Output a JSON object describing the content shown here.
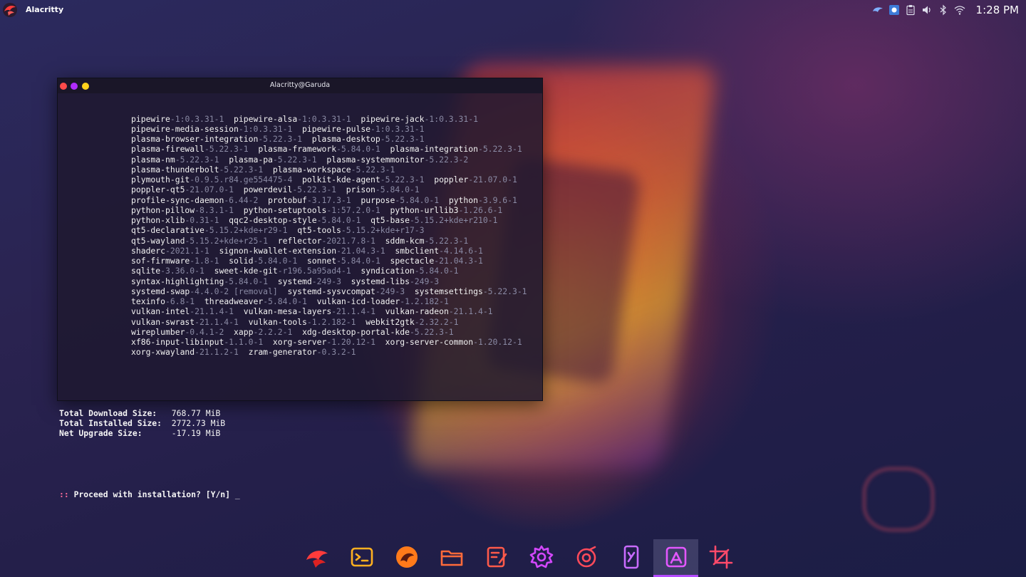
{
  "topbar": {
    "app_name": "Alacritty",
    "clock": "1:28 PM",
    "tray_icons": [
      "falcon-icon",
      "display-icon",
      "clipboard-icon",
      "volume-icon",
      "bluetooth-icon",
      "wifi-icon"
    ]
  },
  "terminal": {
    "title": "Alacritty@Garuda",
    "packages": [
      [
        [
          "pipewire",
          "-1:0.3.31-1"
        ],
        [
          "pipewire-alsa",
          "-1:0.3.31-1"
        ],
        [
          "pipewire-jack",
          "-1:0.3.31-1"
        ]
      ],
      [
        [
          "pipewire-media-session",
          "-1:0.3.31-1"
        ],
        [
          "pipewire-pulse",
          "-1:0.3.31-1"
        ]
      ],
      [
        [
          "plasma-browser-integration",
          "-5.22.3-1"
        ],
        [
          "plasma-desktop",
          "-5.22.3-1"
        ]
      ],
      [
        [
          "plasma-firewall",
          "-5.22.3-1"
        ],
        [
          "plasma-framework",
          "-5.84.0-1"
        ],
        [
          "plasma-integration",
          "-5.22.3-1"
        ]
      ],
      [
        [
          "plasma-nm",
          "-5.22.3-1"
        ],
        [
          "plasma-pa",
          "-5.22.3-1"
        ],
        [
          "plasma-systemmonitor",
          "-5.22.3-2"
        ]
      ],
      [
        [
          "plasma-thunderbolt",
          "-5.22.3-1"
        ],
        [
          "plasma-workspace",
          "-5.22.3-1"
        ]
      ],
      [
        [
          "plymouth-git",
          "-0.9.5.r84.ge554475-4"
        ],
        [
          "polkit-kde-agent",
          "-5.22.3-1"
        ],
        [
          "poppler",
          "-21.07.0-1"
        ]
      ],
      [
        [
          "poppler-qt5",
          "-21.07.0-1"
        ],
        [
          "powerdevil",
          "-5.22.3-1"
        ],
        [
          "prison",
          "-5.84.0-1"
        ]
      ],
      [
        [
          "profile-sync-daemon",
          "-6.44-2"
        ],
        [
          "protobuf",
          "-3.17.3-1"
        ],
        [
          "purpose",
          "-5.84.0-1"
        ],
        [
          "python",
          "-3.9.6-1"
        ]
      ],
      [
        [
          "python-pillow",
          "-8.3.1-1"
        ],
        [
          "python-setuptools",
          "-1:57.2.0-1"
        ],
        [
          "python-urllib3",
          "-1.26.6-1"
        ]
      ],
      [
        [
          "python-xlib",
          "-0.31-1"
        ],
        [
          "qqc2-desktop-style",
          "-5.84.0-1"
        ],
        [
          "qt5-base",
          "-5.15.2+kde+r210-1"
        ]
      ],
      [
        [
          "qt5-declarative",
          "-5.15.2+kde+r29-1"
        ],
        [
          "qt5-tools",
          "-5.15.2+kde+r17-3"
        ]
      ],
      [
        [
          "qt5-wayland",
          "-5.15.2+kde+r25-1"
        ],
        [
          "reflector",
          "-2021.7.8-1"
        ],
        [
          "sddm-kcm",
          "-5.22.3-1"
        ]
      ],
      [
        [
          "shaderc",
          "-2021.1-1"
        ],
        [
          "signon-kwallet-extension",
          "-21.04.3-1"
        ],
        [
          "smbclient",
          "-4.14.6-1"
        ]
      ],
      [
        [
          "sof-firmware",
          "-1.8-1"
        ],
        [
          "solid",
          "-5.84.0-1"
        ],
        [
          "sonnet",
          "-5.84.0-1"
        ],
        [
          "spectacle",
          "-21.04.3-1"
        ]
      ],
      [
        [
          "sqlite",
          "-3.36.0-1"
        ],
        [
          "sweet-kde-git",
          "-r196.5a95ad4-1"
        ],
        [
          "syndication",
          "-5.84.0-1"
        ]
      ],
      [
        [
          "syntax-highlighting",
          "-5.84.0-1"
        ],
        [
          "systemd",
          "-249-3"
        ],
        [
          "systemd-libs",
          "-249-3"
        ]
      ],
      [
        [
          "systemd-swap",
          "-4.4.0-2 [removal]"
        ],
        [
          "systemd-sysvcompat",
          "-249-3"
        ],
        [
          "systemsettings",
          "-5.22.3-1"
        ]
      ],
      [
        [
          "texinfo",
          "-6.8-1"
        ],
        [
          "threadweaver",
          "-5.84.0-1"
        ],
        [
          "vulkan-icd-loader",
          "-1.2.182-1"
        ]
      ],
      [
        [
          "vulkan-intel",
          "-21.1.4-1"
        ],
        [
          "vulkan-mesa-layers",
          "-21.1.4-1"
        ],
        [
          "vulkan-radeon",
          "-21.1.4-1"
        ]
      ],
      [
        [
          "vulkan-swrast",
          "-21.1.4-1"
        ],
        [
          "vulkan-tools",
          "-1.2.182-1"
        ],
        [
          "webkit2gtk",
          "-2.32.2-1"
        ]
      ],
      [
        [
          "wireplumber",
          "-0.4.1-2"
        ],
        [
          "xapp",
          "-2.2.2-1"
        ],
        [
          "xdg-desktop-portal-kde",
          "-5.22.3-1"
        ]
      ],
      [
        [
          "xf86-input-libinput",
          "-1.1.0-1"
        ],
        [
          "xorg-server",
          "-1.20.12-1"
        ],
        [
          "xorg-server-common",
          "-1.20.12-1"
        ]
      ],
      [
        [
          "xorg-xwayland",
          "-21.1.2-1"
        ],
        [
          "zram-generator",
          "-0.3.2-1"
        ]
      ]
    ],
    "summary": [
      {
        "label": "Total Download Size:",
        "value": "   768.77 MiB"
      },
      {
        "label": "Total Installed Size:",
        "value": "  2772.73 MiB"
      },
      {
        "label": "Net Upgrade Size:",
        "value": "      -17.19 MiB"
      }
    ],
    "prompt_prefix": "::",
    "prompt_text": " Proceed with installation? [Y/n] ",
    "cursor": "_"
  },
  "dock": {
    "items": [
      {
        "name": "garuda-welcome",
        "icon": "eagle-icon",
        "color": "#ff3b3b",
        "active": false
      },
      {
        "name": "terminal",
        "icon": "terminal-icon",
        "color": "#ffb020",
        "active": false
      },
      {
        "name": "firedragon-browser",
        "icon": "dragon-icon",
        "color": "#ff7a1a",
        "active": false
      },
      {
        "name": "file-manager",
        "icon": "folder-icon",
        "color": "#ff6a3a",
        "active": false
      },
      {
        "name": "text-editor",
        "icon": "edit-icon",
        "color": "#ff5a4a",
        "active": false
      },
      {
        "name": "system-settings",
        "icon": "gear-icon",
        "color": "#d447ff",
        "active": false
      },
      {
        "name": "octopi",
        "icon": "octopus-icon",
        "color": "#ff4a5a",
        "active": false
      },
      {
        "name": "kde-connect",
        "icon": "phone-icon",
        "color": "#c96bff",
        "active": false
      },
      {
        "name": "alacritty",
        "icon": "alacritty-icon",
        "color": "#e357ff",
        "active": true
      },
      {
        "name": "spectacle",
        "icon": "crop-icon",
        "color": "#ff4a6a",
        "active": false
      }
    ]
  }
}
